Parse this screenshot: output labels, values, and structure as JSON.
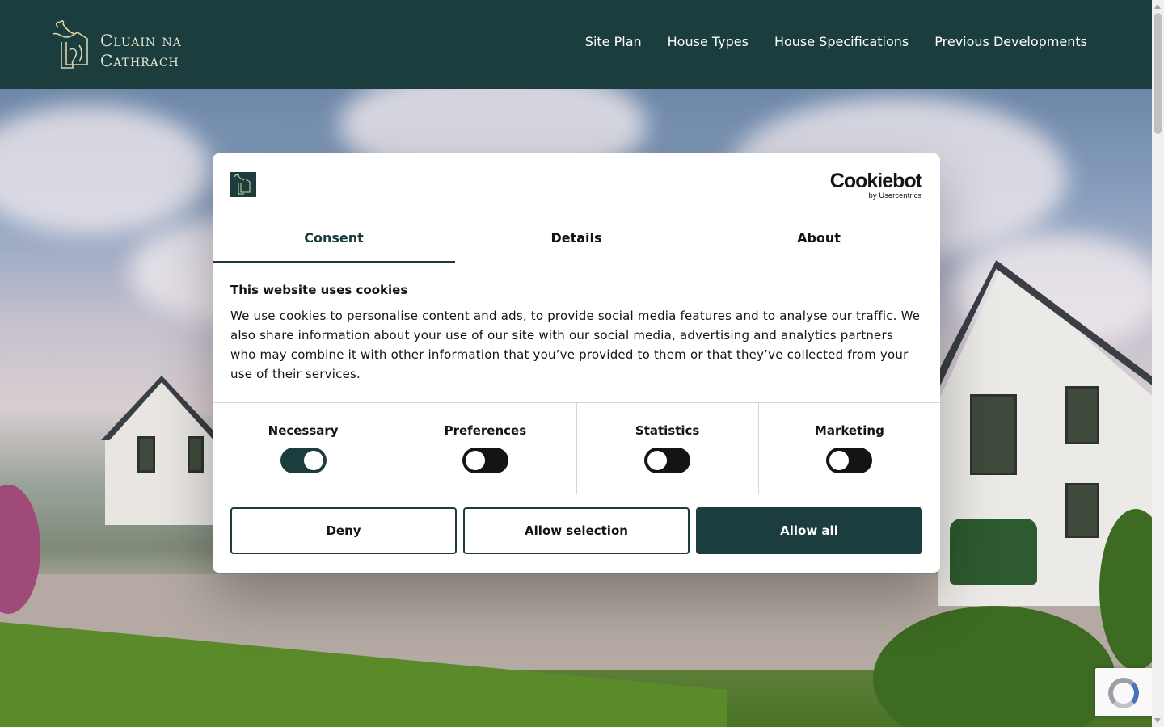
{
  "site": {
    "logo_line1": "Cluain na",
    "logo_line2": "Cathrach"
  },
  "nav": {
    "items": [
      {
        "label": "Site Plan"
      },
      {
        "label": "House Types"
      },
      {
        "label": "House Specifications"
      },
      {
        "label": "Previous Developments"
      }
    ]
  },
  "cookie_dialog": {
    "brand_name": "Cookiebot",
    "brand_sub": "by Usercentrics",
    "tabs": [
      {
        "label": "Consent",
        "active": true
      },
      {
        "label": "Details",
        "active": false
      },
      {
        "label": "About",
        "active": false
      }
    ],
    "title": "This website uses cookies",
    "description": "We use cookies to personalise content and ads, to provide social media features and to analyse our traffic. We also share information about your use of our site with our social media, advertising and analytics partners who may combine it with other information that you’ve provided to them or that they’ve collected from your use of their services.",
    "toggles": [
      {
        "label": "Necessary",
        "on": true
      },
      {
        "label": "Preferences",
        "on": false
      },
      {
        "label": "Statistics",
        "on": false
      },
      {
        "label": "Marketing",
        "on": false
      }
    ],
    "buttons": {
      "deny": "Deny",
      "allow_selection": "Allow selection",
      "allow_all": "Allow all"
    }
  },
  "colors": {
    "brand_dark": "#1b3d3d",
    "logo_gold": "#e9e6cf"
  }
}
